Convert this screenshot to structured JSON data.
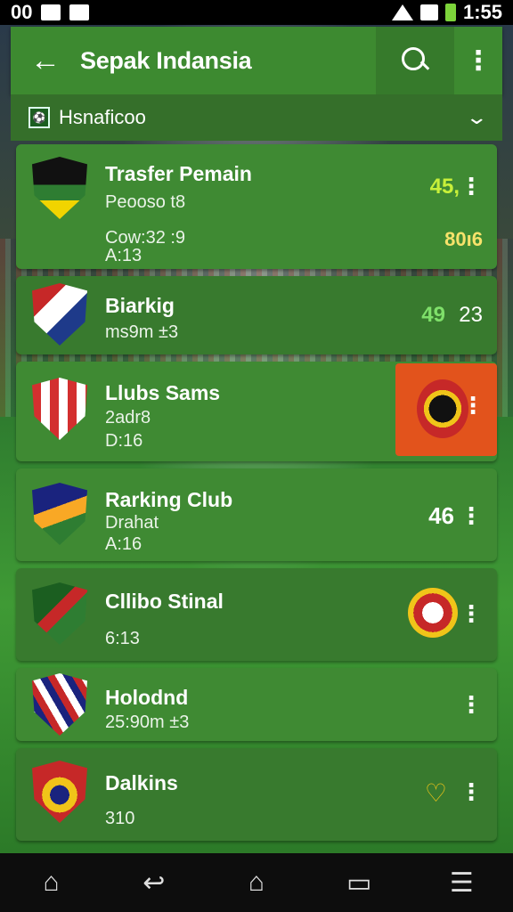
{
  "status_bar": {
    "left_text": "00",
    "time": "1:55"
  },
  "app_bar": {
    "back_glyph": "←",
    "title": "Sepak Indansia",
    "more_glyph": "⋮"
  },
  "filter": {
    "label": "Hsnaficoo",
    "chevron": "⌄"
  },
  "cards": [
    {
      "name": "Trasfer Pemain",
      "line1": "Peooso t8",
      "line2": "Cow:32 :9",
      "line3": "A:13",
      "score": "45,",
      "score_color": "#c8f03a",
      "extra": "80ı6",
      "extra_color": "#f7e26b"
    },
    {
      "name": "Biarkig",
      "line1": "ms9m ±3",
      "score": "49",
      "score_color": "#7fe06a",
      "extra": "23",
      "extra_color": "#ffffff"
    },
    {
      "name": "Llubs Sams",
      "line1": "2adr8",
      "line2": "D:16"
    },
    {
      "name": "Rarking Club",
      "line1": "Drahat",
      "line2": "A:16",
      "score": "46",
      "score_color": "#ffffff"
    },
    {
      "name": "Cllibo Stinal",
      "line1": "6:13"
    },
    {
      "name": "Holodnd",
      "line1": "25:90m ±3"
    },
    {
      "name": "Dalkins",
      "line1": "310"
    }
  ],
  "colors": {
    "card": "#3f8a33",
    "card_alt": "#387a2e",
    "app_bar": "#3d8a30",
    "accent_orange": "#e2531c"
  },
  "icons": {
    "home": "home-icon",
    "back": "back-icon",
    "recents": "recents-icon",
    "menu": "menu-icon"
  }
}
